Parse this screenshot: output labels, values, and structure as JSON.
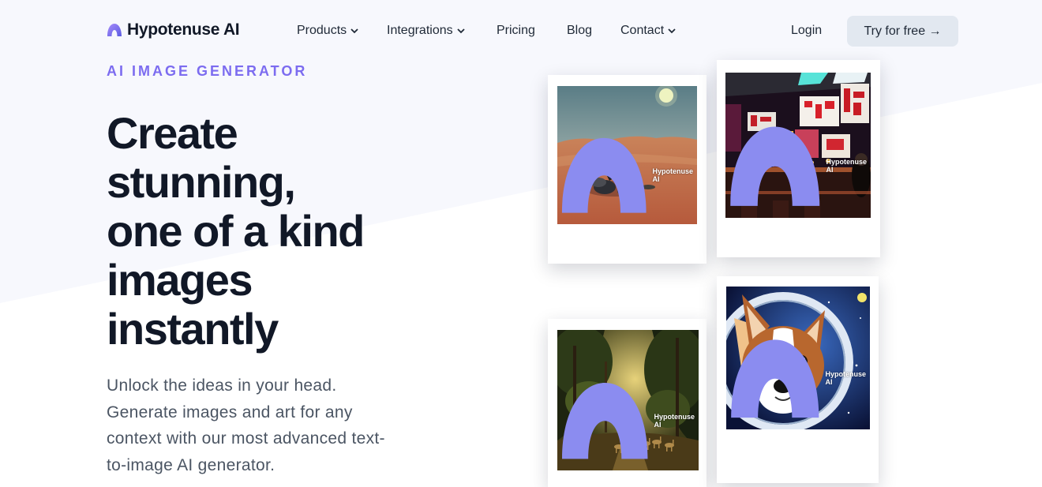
{
  "brand": {
    "name": "Hypotenuse AI",
    "accent_color": "#7c6cf0",
    "logo_icon": "hypotenuse-logo-icon"
  },
  "nav": {
    "items": [
      {
        "label": "Products",
        "has_dropdown": true
      },
      {
        "label": "Integrations",
        "has_dropdown": true
      },
      {
        "label": "Pricing",
        "has_dropdown": false
      },
      {
        "label": "Blog",
        "has_dropdown": false
      },
      {
        "label": "Contact",
        "has_dropdown": true
      }
    ],
    "login_label": "Login",
    "cta_label": "Try for free →"
  },
  "hero": {
    "eyebrow": "AI IMAGE GENERATOR",
    "headline_lines": [
      "Create",
      "stunning,",
      "one of a kind",
      "images",
      "instantly"
    ],
    "subtext": "Unlock the ideas in your head. Generate images and art for any context with our most advanced text-to-image AI generator."
  },
  "gallery": {
    "watermark_label": "Hypotenuse AI",
    "images": [
      {
        "subject": "desert-figure-image"
      },
      {
        "subject": "neon-bar-image"
      },
      {
        "subject": "forest-deer-image"
      },
      {
        "subject": "astronaut-corgi-image"
      }
    ]
  }
}
